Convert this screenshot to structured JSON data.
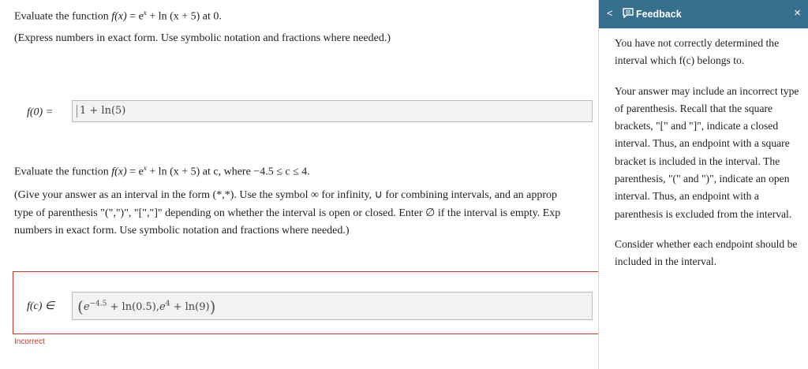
{
  "question1": {
    "line_pre": "Evaluate the function ",
    "fx": "f(x)",
    "line_eq": " = e",
    "exp": "x",
    "line_rest": " + ln (x + 5) at 0.",
    "instruction": "(Express numbers in exact form. Use symbolic notation and fractions where needed.)",
    "answer_label": "f(0) =",
    "answer_value": "1 + ln(5)"
  },
  "question2": {
    "line_pre": "Evaluate the function ",
    "fx": "f(x)",
    "line_eq": " = e",
    "exp": "x",
    "line_rest": " + ln (x + 5) at c, where −4.5 ≤ c ≤ 4.",
    "instruction_lines": [
      "(Give your answer as an interval in the form (*,*). Use the symbol ∞ for infinity, ∪ for combining intervals, and an approp",
      "type of parenthesis \"(\",\")\", \"[\",\"]\" depending on whether the interval is open or closed. Enter ∅ if the interval is empty. Exp",
      "numbers in exact form. Use symbolic notation and fractions where needed.)"
    ],
    "answer_label": "f(c) ∈",
    "answer_parts": {
      "open": "(",
      "base1": "e",
      "exp1": "−4.5",
      "mid1": " + ln(0.5),",
      "base2": "e",
      "exp2": "4",
      "mid2": " + ln(9)",
      "close": ")"
    },
    "status": "Incorrect"
  },
  "feedback": {
    "title": "Feedback",
    "back_glyph": "<",
    "close_glyph": "×",
    "p1": "You have not correctly determined the interval which f(c) belongs to.",
    "p2": "Your answer may include an incorrect type of parenthesis. Recall that the square brackets, \"[\" and \"]\", indicate a closed interval. Thus, an endpoint with a square bracket is included in the interval. The parenthesis, \"(\" and \")\", indicate an open interval. Thus, an endpoint with a parenthesis is excluded from the interval.",
    "p3": "Consider whether each endpoint should be included in the interval."
  },
  "colors": {
    "header": "#34708b",
    "error": "#c9302c"
  }
}
